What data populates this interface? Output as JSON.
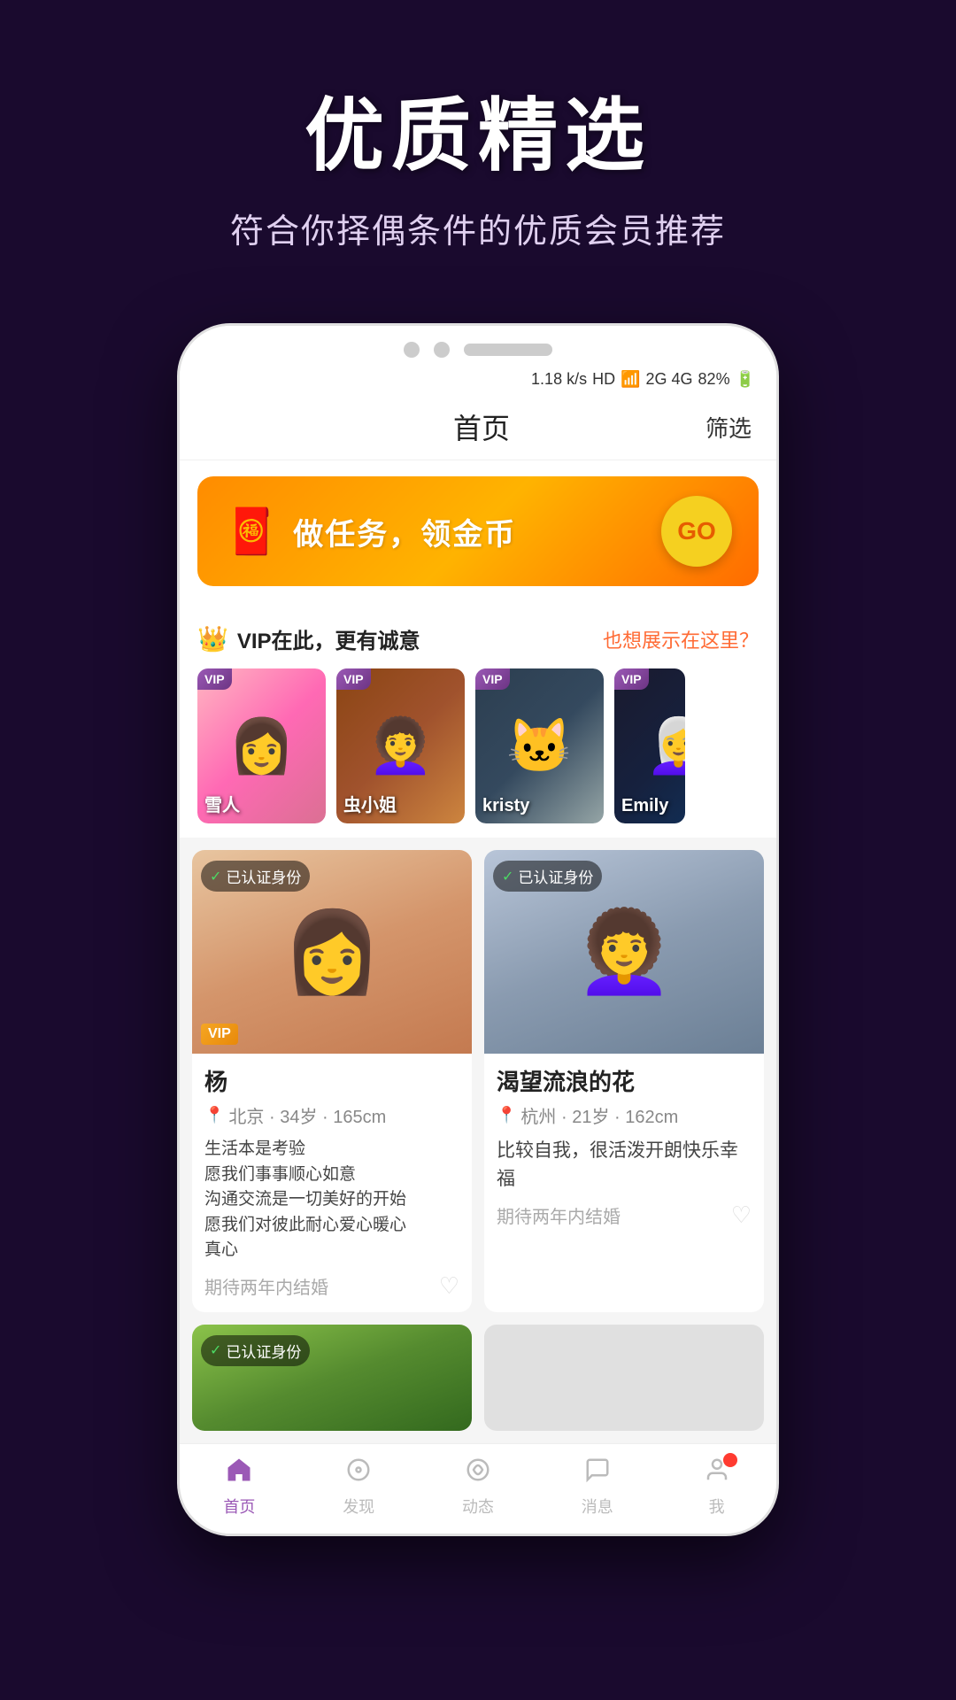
{
  "hero": {
    "title": "优质精选",
    "subtitle": "符合你择偶条件的优质会员推荐"
  },
  "status_bar": {
    "speed": "1.18 k/s",
    "hd": "HD",
    "wifi": "WiFi",
    "signal": "2G 4G",
    "battery": "82%"
  },
  "app_header": {
    "title": "首页",
    "filter": "筛选"
  },
  "banner": {
    "text": "做任务，领金币",
    "go_label": "GO"
  },
  "vip_section": {
    "title": "VIP在此，更有诚意",
    "link": "也想展示在这里？",
    "badge": "VIP",
    "cards": [
      {
        "name": "雪人",
        "badge": "VIP"
      },
      {
        "name": "虫小姐",
        "badge": "VIP"
      },
      {
        "name": "kristy",
        "badge": "VIP"
      },
      {
        "name": "Emily",
        "badge": "VIP"
      }
    ]
  },
  "user_cards": [
    {
      "verified": "已认证身份",
      "name": "杨",
      "vip_badge": "VIP",
      "location": "北京 · 34岁 · 165cm",
      "bio": "生活本是考验\n愿我们事事顺心如意\n沟通交流是一切美好的开始\n愿我们对彼此耐心爱心暖心\n真心",
      "intent": "期待两年内结婚"
    },
    {
      "verified": "已认证身份",
      "name": "渴望流浪的花",
      "vip_badge": "",
      "location": "杭州 · 21岁 · 162cm",
      "bio": "比较自我，很活泼开朗快乐幸福",
      "intent": "期待两年内结婚"
    }
  ],
  "third_card": {
    "verified": "已认证身份"
  },
  "nav": {
    "items": [
      {
        "label": "首页",
        "active": true
      },
      {
        "label": "发现",
        "active": false
      },
      {
        "label": "动态",
        "active": false
      },
      {
        "label": "消息",
        "active": false
      },
      {
        "label": "我",
        "active": false,
        "badge": true
      }
    ]
  }
}
